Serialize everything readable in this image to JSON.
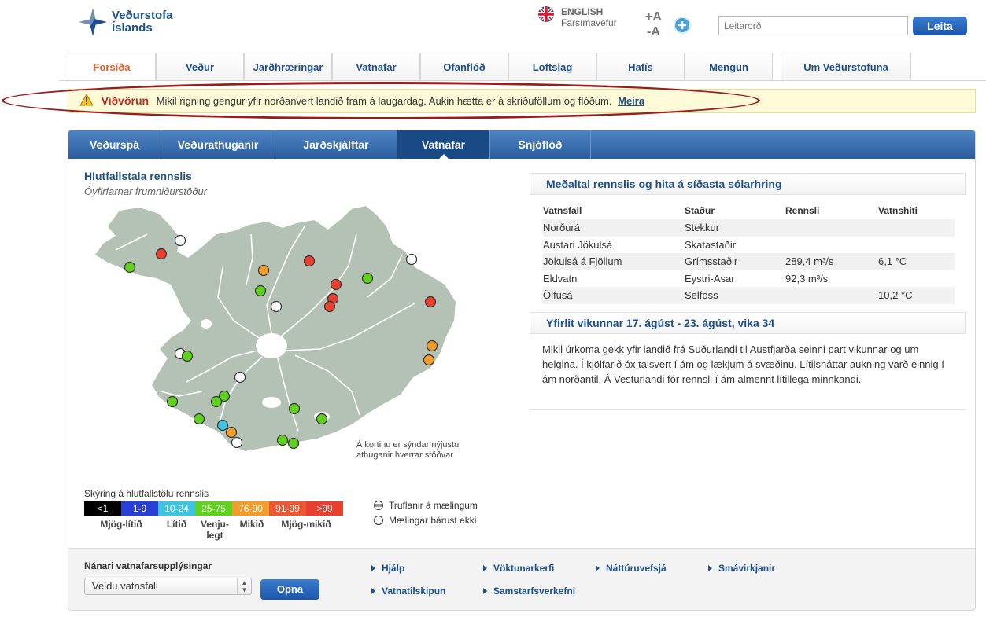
{
  "header": {
    "logo_line1": "Veðurstofa",
    "logo_line2": "Íslands",
    "lang_label": "ENGLISH",
    "mobile_label": "Farsímavefur",
    "font_increase": "+A",
    "font_decrease": "-A",
    "search_placeholder": "Leitarorð",
    "search_button": "Leita"
  },
  "main_tabs": [
    "Forsíða",
    "Veður",
    "Jarðhræringar",
    "Vatnafar",
    "Ofanflóð",
    "Loftslag",
    "Hafís",
    "Mengun",
    "Um Veðurstofuna"
  ],
  "warning": {
    "label": "Viðvörun",
    "text": "Mikil rigning gengur yfir norðanvert landið fram á laugardag. Aukin hætta er á skriðuföllum og flóðum.",
    "link": "Meira"
  },
  "sub_tabs": [
    "Veðurspá",
    "Veðurathuganir",
    "Jarðskjálftar",
    "Vatnafar",
    "Snjóflóð"
  ],
  "map": {
    "title": "Hlutfallstala rennslis",
    "subtitle": "Óyfirfarnar frumniðurstöður",
    "note": "Á kortinu er sýndar nýjustu athuganir hverrar stöðvar"
  },
  "legend": {
    "title": "Skýring á hlutfallstölu rennslis",
    "cells": [
      {
        "label": "<1",
        "color": "#000000",
        "text_color": "#ffffff"
      },
      {
        "label": "1-9",
        "color": "#2a3fd8",
        "text_color": "#ffffff"
      },
      {
        "label": "10-24",
        "color": "#3ec3e0",
        "text_color": "#ffffff"
      },
      {
        "label": "25-75",
        "color": "#5fd11e",
        "text_color": "#ffffff"
      },
      {
        "label": "76-90",
        "color": "#f29d2b",
        "text_color": "#ffffff"
      },
      {
        "label": "91-99",
        "color": "#eb5a34",
        "text_color": "#ffffff"
      },
      {
        "label": ">99",
        "color": "#e8402e",
        "text_color": "#ffffff"
      }
    ],
    "class_labels": [
      "Mjög-lítið",
      "Lítið",
      "Venju-legt",
      "Mikið",
      "Mjög-mikið"
    ],
    "symbol_disturbed": "Truflanir á mælingum",
    "symbol_missing": "Mælingar bárust ekki"
  },
  "flow_box": {
    "title": "Meðaltal rennslis og hita á síðasta sólarhring",
    "columns": [
      "Vatnsfall",
      "Staður",
      "Rennsli",
      "Vatnshiti"
    ],
    "rows": [
      [
        "Norðurá",
        "Stekkur",
        "",
        ""
      ],
      [
        "Austari Jökulsá",
        "Skatastaðir",
        "",
        ""
      ],
      [
        "Jökulsá á Fjöllum",
        "Grímsstaðir",
        "289,4 m³/s",
        "6,1 °C"
      ],
      [
        "Eldvatn",
        "Eystri-Ásar",
        "92,3 m³/s",
        ""
      ],
      [
        "Ölfusá",
        "Selfoss",
        "",
        "10,2 °C"
      ]
    ]
  },
  "weekly": {
    "title": "Yfirlit vikunnar 17. ágúst - 23. ágúst, vika 34",
    "text": "Mikil úrkoma gekk yfir landið frá Suðurlandi til Austfjarða seinni part vikunnar og um helgina. Í kjölfarið óx talsvert í ám og lækjum á svæðinu. Lítilsháttar aukning varð einnig í ám norðantil. Á Vesturlandi fór rennsli í ám almennt lítillega minnkandi."
  },
  "footer": {
    "title": "Nánari vatnafarsupplýsingar",
    "select_value": "Veldu vatnsfall",
    "open_button": "Opna",
    "links": [
      "Hjálp",
      "Vöktunarkerfi",
      "Náttúruvefsjá",
      "Smávirkjanir",
      "Vatnatilskipun",
      "Samstarfsverkefni"
    ]
  },
  "colors": {
    "brand_blue": "#1d4f8a",
    "active_tab": "#e8602a",
    "warning_red": "#c4291c",
    "map_land": "#b4c2b5"
  }
}
